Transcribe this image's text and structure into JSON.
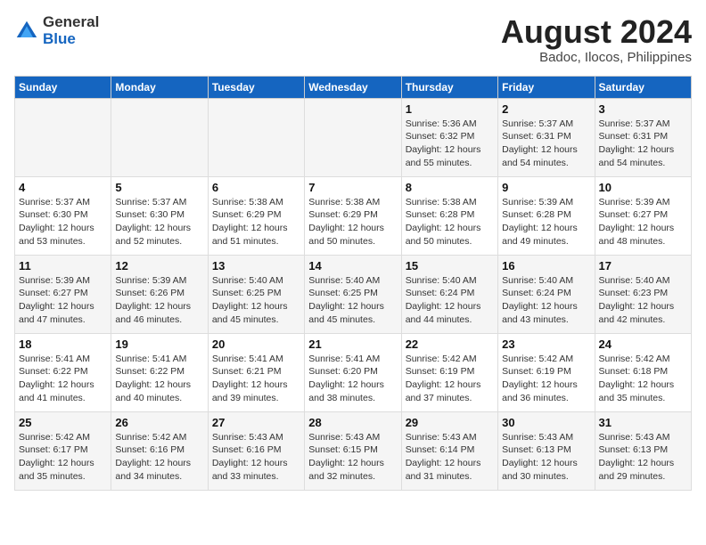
{
  "header": {
    "logo_line1": "General",
    "logo_line2": "Blue",
    "month_year": "August 2024",
    "location": "Badoc, Ilocos, Philippines"
  },
  "weekdays": [
    "Sunday",
    "Monday",
    "Tuesday",
    "Wednesday",
    "Thursday",
    "Friday",
    "Saturday"
  ],
  "weeks": [
    [
      {
        "day": "",
        "info": ""
      },
      {
        "day": "",
        "info": ""
      },
      {
        "day": "",
        "info": ""
      },
      {
        "day": "",
        "info": ""
      },
      {
        "day": "1",
        "info": "Sunrise: 5:36 AM\nSunset: 6:32 PM\nDaylight: 12 hours\nand 55 minutes."
      },
      {
        "day": "2",
        "info": "Sunrise: 5:37 AM\nSunset: 6:31 PM\nDaylight: 12 hours\nand 54 minutes."
      },
      {
        "day": "3",
        "info": "Sunrise: 5:37 AM\nSunset: 6:31 PM\nDaylight: 12 hours\nand 54 minutes."
      }
    ],
    [
      {
        "day": "4",
        "info": "Sunrise: 5:37 AM\nSunset: 6:30 PM\nDaylight: 12 hours\nand 53 minutes."
      },
      {
        "day": "5",
        "info": "Sunrise: 5:37 AM\nSunset: 6:30 PM\nDaylight: 12 hours\nand 52 minutes."
      },
      {
        "day": "6",
        "info": "Sunrise: 5:38 AM\nSunset: 6:29 PM\nDaylight: 12 hours\nand 51 minutes."
      },
      {
        "day": "7",
        "info": "Sunrise: 5:38 AM\nSunset: 6:29 PM\nDaylight: 12 hours\nand 50 minutes."
      },
      {
        "day": "8",
        "info": "Sunrise: 5:38 AM\nSunset: 6:28 PM\nDaylight: 12 hours\nand 50 minutes."
      },
      {
        "day": "9",
        "info": "Sunrise: 5:39 AM\nSunset: 6:28 PM\nDaylight: 12 hours\nand 49 minutes."
      },
      {
        "day": "10",
        "info": "Sunrise: 5:39 AM\nSunset: 6:27 PM\nDaylight: 12 hours\nand 48 minutes."
      }
    ],
    [
      {
        "day": "11",
        "info": "Sunrise: 5:39 AM\nSunset: 6:27 PM\nDaylight: 12 hours\nand 47 minutes."
      },
      {
        "day": "12",
        "info": "Sunrise: 5:39 AM\nSunset: 6:26 PM\nDaylight: 12 hours\nand 46 minutes."
      },
      {
        "day": "13",
        "info": "Sunrise: 5:40 AM\nSunset: 6:25 PM\nDaylight: 12 hours\nand 45 minutes."
      },
      {
        "day": "14",
        "info": "Sunrise: 5:40 AM\nSunset: 6:25 PM\nDaylight: 12 hours\nand 45 minutes."
      },
      {
        "day": "15",
        "info": "Sunrise: 5:40 AM\nSunset: 6:24 PM\nDaylight: 12 hours\nand 44 minutes."
      },
      {
        "day": "16",
        "info": "Sunrise: 5:40 AM\nSunset: 6:24 PM\nDaylight: 12 hours\nand 43 minutes."
      },
      {
        "day": "17",
        "info": "Sunrise: 5:40 AM\nSunset: 6:23 PM\nDaylight: 12 hours\nand 42 minutes."
      }
    ],
    [
      {
        "day": "18",
        "info": "Sunrise: 5:41 AM\nSunset: 6:22 PM\nDaylight: 12 hours\nand 41 minutes."
      },
      {
        "day": "19",
        "info": "Sunrise: 5:41 AM\nSunset: 6:22 PM\nDaylight: 12 hours\nand 40 minutes."
      },
      {
        "day": "20",
        "info": "Sunrise: 5:41 AM\nSunset: 6:21 PM\nDaylight: 12 hours\nand 39 minutes."
      },
      {
        "day": "21",
        "info": "Sunrise: 5:41 AM\nSunset: 6:20 PM\nDaylight: 12 hours\nand 38 minutes."
      },
      {
        "day": "22",
        "info": "Sunrise: 5:42 AM\nSunset: 6:19 PM\nDaylight: 12 hours\nand 37 minutes."
      },
      {
        "day": "23",
        "info": "Sunrise: 5:42 AM\nSunset: 6:19 PM\nDaylight: 12 hours\nand 36 minutes."
      },
      {
        "day": "24",
        "info": "Sunrise: 5:42 AM\nSunset: 6:18 PM\nDaylight: 12 hours\nand 35 minutes."
      }
    ],
    [
      {
        "day": "25",
        "info": "Sunrise: 5:42 AM\nSunset: 6:17 PM\nDaylight: 12 hours\nand 35 minutes."
      },
      {
        "day": "26",
        "info": "Sunrise: 5:42 AM\nSunset: 6:16 PM\nDaylight: 12 hours\nand 34 minutes."
      },
      {
        "day": "27",
        "info": "Sunrise: 5:43 AM\nSunset: 6:16 PM\nDaylight: 12 hours\nand 33 minutes."
      },
      {
        "day": "28",
        "info": "Sunrise: 5:43 AM\nSunset: 6:15 PM\nDaylight: 12 hours\nand 32 minutes."
      },
      {
        "day": "29",
        "info": "Sunrise: 5:43 AM\nSunset: 6:14 PM\nDaylight: 12 hours\nand 31 minutes."
      },
      {
        "day": "30",
        "info": "Sunrise: 5:43 AM\nSunset: 6:13 PM\nDaylight: 12 hours\nand 30 minutes."
      },
      {
        "day": "31",
        "info": "Sunrise: 5:43 AM\nSunset: 6:13 PM\nDaylight: 12 hours\nand 29 minutes."
      }
    ]
  ]
}
